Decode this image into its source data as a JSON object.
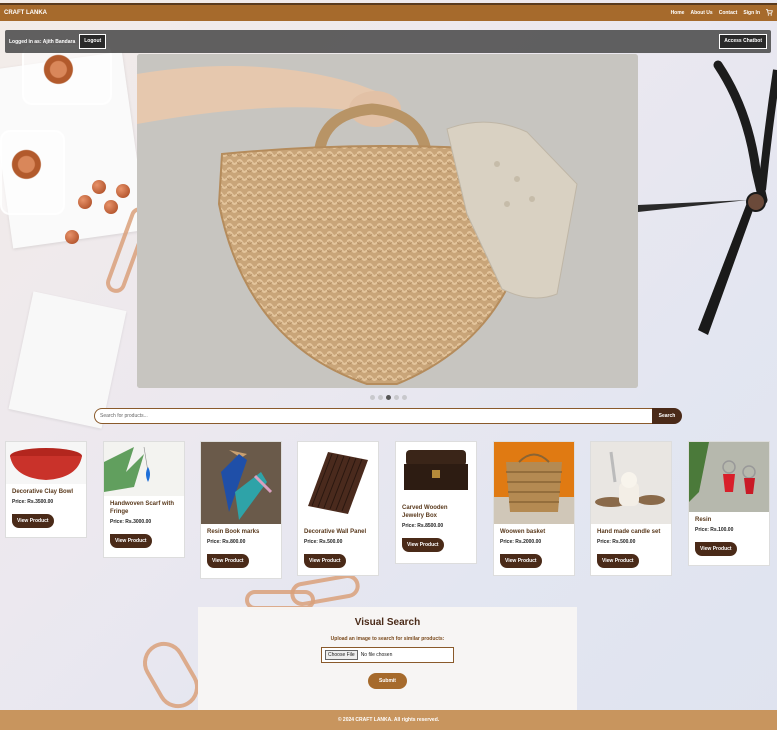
{
  "nav": {
    "brand": "CRAFT LANKA",
    "links": [
      "Home",
      "About Us",
      "Contact",
      "Sign In"
    ],
    "cart_icon": "cart-icon"
  },
  "userbar": {
    "logged_in_label": "Logged in as:",
    "username": "Ajith Bandara",
    "logout_label": "Logout",
    "chatbot_label": "Access Chatbot"
  },
  "carousel": {
    "slide_count": 5,
    "active_index": 2
  },
  "search": {
    "placeholder": "Search for products...",
    "button_label": "Search"
  },
  "products": [
    {
      "title": "Decorative Clay Bowl",
      "price": "Price: Rs.3500.00",
      "button": "View Product"
    },
    {
      "title": "Handwoven Scarf with Fringe",
      "price": "Price: Rs.3000.00",
      "button": "View Product"
    },
    {
      "title": "Resin Book marks",
      "price": "Price: Rs.800.00",
      "button": "View Product"
    },
    {
      "title": "Decorative Wall Panel",
      "price": "Price: Rs.500.00",
      "button": "View Product"
    },
    {
      "title": "Carved Wooden Jewelry Box",
      "price": "Price: Rs.8500.00",
      "button": "View Product"
    },
    {
      "title": "Woowen basket",
      "price": "Price: Rs.2000.00",
      "button": "View Product"
    },
    {
      "title": "Hand made candle set",
      "price": "Price: Rs.500.00",
      "button": "View Product"
    },
    {
      "title": "Resin",
      "price": "Price: Rs.100.00",
      "button": "View Product"
    }
  ],
  "visual_search": {
    "title": "Visual Search",
    "subtitle": "Upload an image to search for similar products:",
    "file_button": "Choose File",
    "file_status": "No file chosen",
    "submit_label": "Submit"
  },
  "footer": {
    "text": "© 2024 CRAFT LANKA. All rights reserved."
  },
  "colors": {
    "brand": "#a66a2c",
    "dark_brown": "#4a2a18",
    "footer": "#c8955e"
  }
}
